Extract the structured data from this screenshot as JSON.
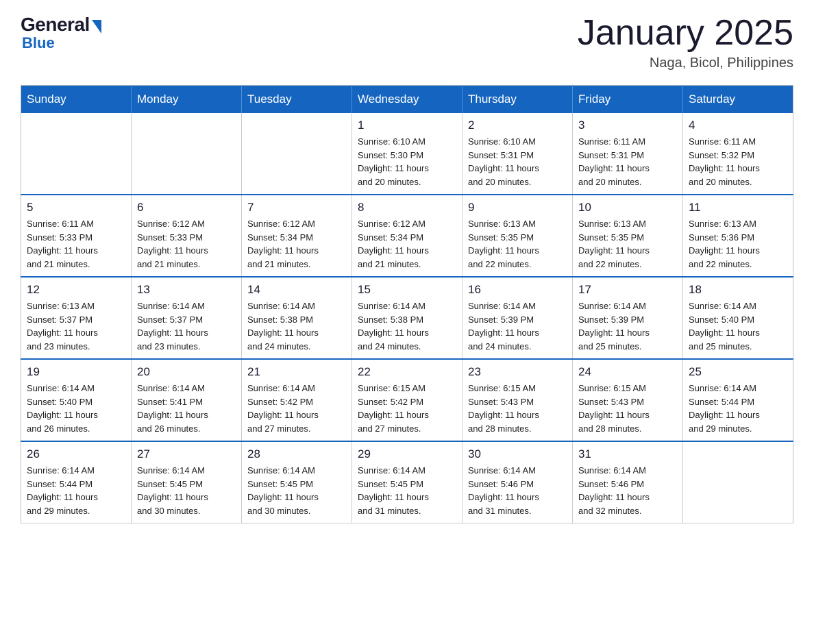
{
  "header": {
    "logo": {
      "general": "General",
      "blue": "Blue"
    },
    "title": "January 2025",
    "location": "Naga, Bicol, Philippines"
  },
  "calendar": {
    "days_of_week": [
      "Sunday",
      "Monday",
      "Tuesday",
      "Wednesday",
      "Thursday",
      "Friday",
      "Saturday"
    ],
    "weeks": [
      [
        {
          "day": "",
          "info": ""
        },
        {
          "day": "",
          "info": ""
        },
        {
          "day": "",
          "info": ""
        },
        {
          "day": "1",
          "info": "Sunrise: 6:10 AM\nSunset: 5:30 PM\nDaylight: 11 hours\nand 20 minutes."
        },
        {
          "day": "2",
          "info": "Sunrise: 6:10 AM\nSunset: 5:31 PM\nDaylight: 11 hours\nand 20 minutes."
        },
        {
          "day": "3",
          "info": "Sunrise: 6:11 AM\nSunset: 5:31 PM\nDaylight: 11 hours\nand 20 minutes."
        },
        {
          "day": "4",
          "info": "Sunrise: 6:11 AM\nSunset: 5:32 PM\nDaylight: 11 hours\nand 20 minutes."
        }
      ],
      [
        {
          "day": "5",
          "info": "Sunrise: 6:11 AM\nSunset: 5:33 PM\nDaylight: 11 hours\nand 21 minutes."
        },
        {
          "day": "6",
          "info": "Sunrise: 6:12 AM\nSunset: 5:33 PM\nDaylight: 11 hours\nand 21 minutes."
        },
        {
          "day": "7",
          "info": "Sunrise: 6:12 AM\nSunset: 5:34 PM\nDaylight: 11 hours\nand 21 minutes."
        },
        {
          "day": "8",
          "info": "Sunrise: 6:12 AM\nSunset: 5:34 PM\nDaylight: 11 hours\nand 21 minutes."
        },
        {
          "day": "9",
          "info": "Sunrise: 6:13 AM\nSunset: 5:35 PM\nDaylight: 11 hours\nand 22 minutes."
        },
        {
          "day": "10",
          "info": "Sunrise: 6:13 AM\nSunset: 5:35 PM\nDaylight: 11 hours\nand 22 minutes."
        },
        {
          "day": "11",
          "info": "Sunrise: 6:13 AM\nSunset: 5:36 PM\nDaylight: 11 hours\nand 22 minutes."
        }
      ],
      [
        {
          "day": "12",
          "info": "Sunrise: 6:13 AM\nSunset: 5:37 PM\nDaylight: 11 hours\nand 23 minutes."
        },
        {
          "day": "13",
          "info": "Sunrise: 6:14 AM\nSunset: 5:37 PM\nDaylight: 11 hours\nand 23 minutes."
        },
        {
          "day": "14",
          "info": "Sunrise: 6:14 AM\nSunset: 5:38 PM\nDaylight: 11 hours\nand 24 minutes."
        },
        {
          "day": "15",
          "info": "Sunrise: 6:14 AM\nSunset: 5:38 PM\nDaylight: 11 hours\nand 24 minutes."
        },
        {
          "day": "16",
          "info": "Sunrise: 6:14 AM\nSunset: 5:39 PM\nDaylight: 11 hours\nand 24 minutes."
        },
        {
          "day": "17",
          "info": "Sunrise: 6:14 AM\nSunset: 5:39 PM\nDaylight: 11 hours\nand 25 minutes."
        },
        {
          "day": "18",
          "info": "Sunrise: 6:14 AM\nSunset: 5:40 PM\nDaylight: 11 hours\nand 25 minutes."
        }
      ],
      [
        {
          "day": "19",
          "info": "Sunrise: 6:14 AM\nSunset: 5:40 PM\nDaylight: 11 hours\nand 26 minutes."
        },
        {
          "day": "20",
          "info": "Sunrise: 6:14 AM\nSunset: 5:41 PM\nDaylight: 11 hours\nand 26 minutes."
        },
        {
          "day": "21",
          "info": "Sunrise: 6:14 AM\nSunset: 5:42 PM\nDaylight: 11 hours\nand 27 minutes."
        },
        {
          "day": "22",
          "info": "Sunrise: 6:15 AM\nSunset: 5:42 PM\nDaylight: 11 hours\nand 27 minutes."
        },
        {
          "day": "23",
          "info": "Sunrise: 6:15 AM\nSunset: 5:43 PM\nDaylight: 11 hours\nand 28 minutes."
        },
        {
          "day": "24",
          "info": "Sunrise: 6:15 AM\nSunset: 5:43 PM\nDaylight: 11 hours\nand 28 minutes."
        },
        {
          "day": "25",
          "info": "Sunrise: 6:14 AM\nSunset: 5:44 PM\nDaylight: 11 hours\nand 29 minutes."
        }
      ],
      [
        {
          "day": "26",
          "info": "Sunrise: 6:14 AM\nSunset: 5:44 PM\nDaylight: 11 hours\nand 29 minutes."
        },
        {
          "day": "27",
          "info": "Sunrise: 6:14 AM\nSunset: 5:45 PM\nDaylight: 11 hours\nand 30 minutes."
        },
        {
          "day": "28",
          "info": "Sunrise: 6:14 AM\nSunset: 5:45 PM\nDaylight: 11 hours\nand 30 minutes."
        },
        {
          "day": "29",
          "info": "Sunrise: 6:14 AM\nSunset: 5:45 PM\nDaylight: 11 hours\nand 31 minutes."
        },
        {
          "day": "30",
          "info": "Sunrise: 6:14 AM\nSunset: 5:46 PM\nDaylight: 11 hours\nand 31 minutes."
        },
        {
          "day": "31",
          "info": "Sunrise: 6:14 AM\nSunset: 5:46 PM\nDaylight: 11 hours\nand 32 minutes."
        },
        {
          "day": "",
          "info": ""
        }
      ]
    ]
  }
}
